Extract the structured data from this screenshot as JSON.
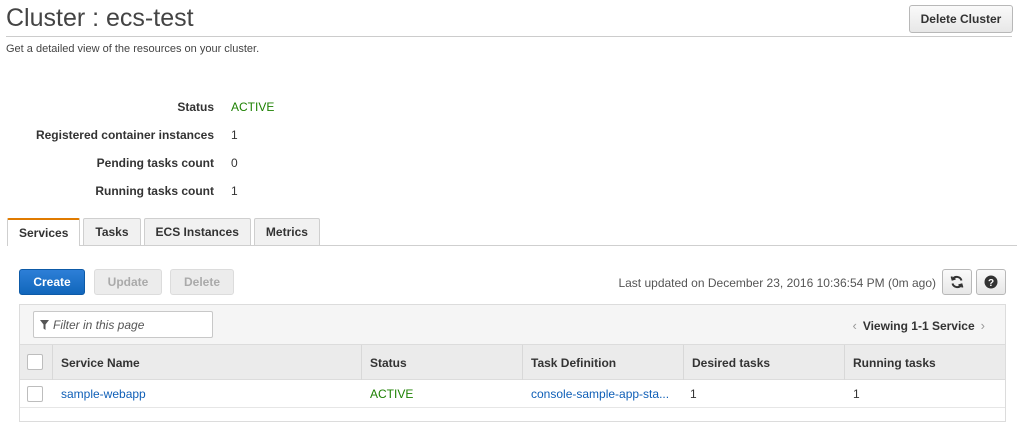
{
  "header": {
    "title": "Cluster : ecs-test",
    "delete_cluster_label": "Delete Cluster",
    "subtitle": "Get a detailed view of the resources on your cluster."
  },
  "details": [
    {
      "label": "Status",
      "value": "ACTIVE"
    },
    {
      "label": "Registered container instances",
      "value": "1"
    },
    {
      "label": "Pending tasks count",
      "value": "0"
    },
    {
      "label": "Running tasks count",
      "value": "1"
    }
  ],
  "tabs": [
    {
      "label": "Services",
      "selected": true
    },
    {
      "label": "Tasks",
      "selected": false
    },
    {
      "label": "ECS Instances",
      "selected": false
    },
    {
      "label": "Metrics",
      "selected": false
    }
  ],
  "toolbar": {
    "create_label": "Create",
    "update_label": "Update",
    "delete_label": "Delete",
    "last_updated": "Last updated on December 23, 2016 10:36:54 PM (0m ago)",
    "refresh_icon": "refresh-icon",
    "help_icon": "help-icon"
  },
  "table": {
    "filter_placeholder": "Filter in this page",
    "viewing": "Viewing 1-1 Service",
    "columns": [
      "Service Name",
      "Status",
      "Task Definition",
      "Desired tasks",
      "Running tasks"
    ],
    "rows": [
      {
        "service_name": "sample-webapp",
        "status": "ACTIVE",
        "task_definition": "console-sample-app-sta...",
        "desired_tasks": "1",
        "running_tasks": "1"
      }
    ]
  },
  "colors": {
    "primary": "#1166bb",
    "active": "#1d8102",
    "tab_accent": "#e07b00",
    "link": "#0f5fb7"
  }
}
